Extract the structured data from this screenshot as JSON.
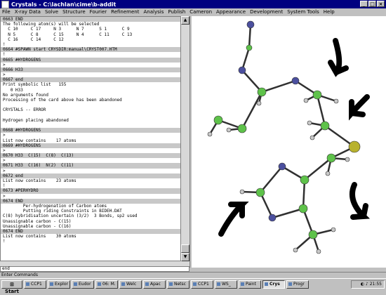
{
  "window": {
    "title": "Crystals - C:\\lachlan\\cime\\b-addit"
  },
  "menu": [
    "File",
    "X-ray Data",
    "Solve",
    "Structure",
    "Fourier",
    "Refinement",
    "Analysis",
    "Publish",
    "Cameron",
    "Appearance",
    "Development",
    "System Tools",
    "Help"
  ],
  "text_lines": [
    {
      "t": "0663 END",
      "h": true
    },
    {
      "t": "The following atom(s) will be selected",
      "h": false
    },
    {
      "t": "  C 10     C 17     N 3      N 7      S 1      C 9",
      "h": false
    },
    {
      "t": "  N 5      C 8      C 15     N 4      C 11     C 13",
      "h": false
    },
    {
      "t": "  C 16     C 14     C 12",
      "h": false
    },
    {
      "t": "!",
      "h": false
    },
    {
      "t": "0664 #SPAWN start CRYSDIR:manual\\CRYST007.HTM",
      "h": true
    },
    {
      "t": "!",
      "h": false
    },
    {
      "t": "0665 #HYDROGENS",
      "h": true
    },
    {
      "t": ">",
      "h": false
    },
    {
      "t": "0666 H33",
      "h": true
    },
    {
      "t": ">",
      "h": false
    },
    {
      "t": "0667 end",
      "h": true
    },
    {
      "t": "Print symbolic list   155",
      "h": false
    },
    {
      "t": "   0 H33",
      "h": false
    },
    {
      "t": "No arguments found",
      "h": false
    },
    {
      "t": "Processing of the card above has been abandoned",
      "h": false
    },
    {
      "t": "",
      "h": false
    },
    {
      "t": "CRYSTALS -- ERROR",
      "h": false
    },
    {
      "t": "",
      "h": false
    },
    {
      "t": "Hydrogen placing abandoned",
      "h": false
    },
    {
      "t": "",
      "h": false
    },
    {
      "t": "0668 #HYDROGENS",
      "h": true
    },
    {
      "t": ">",
      "h": false
    },
    {
      "t": "List now contains    17 atoms",
      "h": false
    },
    {
      "t": "0669 #HYDROGENS",
      "h": true
    },
    {
      "t": ">",
      "h": false
    },
    {
      "t": "0670 H33  C(15)  C(8)  C(13)",
      "h": true
    },
    {
      "t": ">",
      "h": false
    },
    {
      "t": "0671 H33  C(16)  N(2)  C(11)",
      "h": true
    },
    {
      "t": ">",
      "h": false
    },
    {
      "t": "0672 end",
      "h": true
    },
    {
      "t": "List now contains    23 atoms",
      "h": false
    },
    {
      "t": "!",
      "h": false
    },
    {
      "t": "0673 #PERHYDRO",
      "h": true
    },
    {
      "t": ">",
      "h": false
    },
    {
      "t": "0674 END",
      "h": true
    },
    {
      "t": "        Per-hydrogenation of Carbon atoms",
      "h": false
    },
    {
      "t": "        Putting riding Constraints in BIDEH.DAT",
      "h": false
    },
    {
      "t": "C(8) hybridisation uncertain (3/2)  3 Bonds, sp2 used",
      "h": false
    },
    {
      "t": "Unassignable carbon - C(15)",
      "h": false
    },
    {
      "t": "Unassignable carbon - C(16)",
      "h": false
    },
    {
      "t": "0674 END",
      "h": true
    },
    {
      "t": "List now contains    30 atoms",
      "h": false
    },
    {
      "t": "!",
      "h": false
    },
    {
      "t": "",
      "h": false
    }
  ],
  "command_input": {
    "value": "end"
  },
  "status_bar": {
    "text": "Enter Commands"
  },
  "taskbar": {
    "start_label": "Start",
    "items": [
      {
        "label": "CCP1",
        "active": false
      },
      {
        "label": "Explor",
        "active": false
      },
      {
        "label": "Eudor",
        "active": false
      },
      {
        "label": "06: M.",
        "active": false
      },
      {
        "label": "Welc",
        "active": false
      },
      {
        "label": "Apac",
        "active": false
      },
      {
        "label": "Netsc",
        "active": false
      },
      {
        "label": "CCP1",
        "active": false
      },
      {
        "label": "WS_",
        "active": false
      },
      {
        "label": "Paint",
        "active": false
      },
      {
        "label": "Crys",
        "active": true
      },
      {
        "label": "Progr",
        "active": false
      }
    ],
    "clock": "21:55"
  },
  "colors": {
    "titlebar": "#000080",
    "carbon": "#5ec24a",
    "nitrogen": "#4b4f9e",
    "sulfur": "#b8b22e",
    "hydrogen": "#c8c8c8",
    "bond": "#303030"
  },
  "icons": [
    "app-icon",
    "minimize-icon",
    "maximize-icon",
    "close-icon",
    "scroll-up-icon",
    "scroll-down-icon",
    "windows-logo-icon",
    "tray-icons"
  ]
}
